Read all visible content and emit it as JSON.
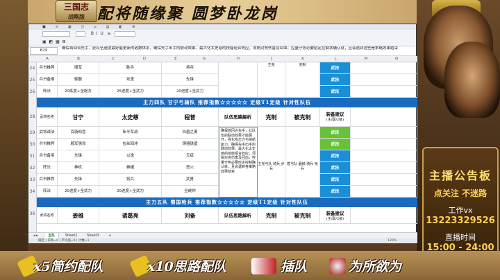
{
  "banner": {
    "logo_text": "三国志",
    "logo_sub": "战略版",
    "title": "配将随缘聚 圆梦卧龙岗"
  },
  "notice": {
    "title": "主播公告板",
    "line1": "点关注 不迷路",
    "wechat_label": "工作vx",
    "wechat_number": "13223329526",
    "live_label": "直播时间",
    "live_time": "15:00 - 24:00"
  },
  "bottom_bar": {
    "item1": "x5简约配队",
    "item2": "x10思路配队",
    "item3": "插队",
    "item4": "为所欲为"
  },
  "spreadsheet": {
    "name_box": "B29",
    "formula_text": "确保首回合先手，此队伍速度最好能更新的敌数体系，确保先手出手的联动效果，最大化太史慈的技能组合效应，须稍对充伤害及回血，控量守势必要给定控制状确认就，且会遇到这些是策略效果结束",
    "row_numbers": [
      "24",
      "25",
      "26",
      "",
      "28",
      "29",
      "30",
      "31",
      "32",
      "33",
      "34",
      "",
      "36"
    ],
    "col_letters": [
      "A",
      "B",
      "C",
      "D",
      "E",
      "F",
      "G",
      "H",
      "I",
      "J",
      "K",
      "L",
      "M",
      "N",
      "O"
    ],
    "top_rows": [
      {
        "role": "兵书推荐",
        "c": "顺军",
        "e": "胜兵",
        "g": "将兵",
        "rec": "武技"
      },
      {
        "role": "兵书备用",
        "c": "御器",
        "e": "攻坚",
        "g": "先锋",
        "rec": "武技"
      },
      {
        "role": "阵法",
        "c": "20练度+全配方",
        "e": "25进度+全武力",
        "g": "20进度+全武力",
        "rec": "武技"
      }
    ],
    "team4_bar": "主力四队 甘宁弓骑队 推荐指数☆☆☆☆☆ 定级T1定级 针对性队伍",
    "team4_header": {
      "role": "武将名称",
      "hero1": "甘宁",
      "hero2": "太史慈",
      "hero3": "程普",
      "analysis": "队伍思路解析",
      "counter": "克制",
      "countered": "被克制",
      "gear": "装备建议",
      "gear_sub": "(主/副/2级)"
    },
    "team4_rows": [
      {
        "role": "武将战法",
        "c": "百骑劫营",
        "e": "斩半军战",
        "g": "白眉之勇",
        "rec": "武技",
        "rec_color": "green"
      },
      {
        "role": "兵书推荐",
        "c": "顺军强攻",
        "e": "拉丝回冲",
        "g": "铜墙铁壁",
        "rec": "武技",
        "rec_color": "green"
      },
      {
        "role": "兵书备用",
        "c": "先锋",
        "e": "以逸",
        "g": "无疵",
        "rec": "武技",
        "rec_color": "blue"
      },
      {
        "role": "阵法",
        "c": "神机",
        "e": "帷幄",
        "g": "怒火",
        "rec": "武技",
        "rec_color": "blue"
      },
      {
        "role": "兵书推荐",
        "c": "先锋",
        "e": "将兵",
        "g": "武勇",
        "rec": "武技",
        "rec_color": "blue"
      },
      {
        "role": "阵法",
        "c": "20进度+全武力",
        "e": "20进度+全武力",
        "g": "全统帅",
        "rec": "武技",
        "rec_color": "blue"
      }
    ],
    "team4_note": "确保首回合先手，此队伍的联动效果才能展开，强化攻击力与续航能力，确保先手出手的联动效果，最大化太史慈的技能组合效应，须稍对克伤害及回血，控量守势必要时定控制确认就，且会遇到各策略效果结束",
    "team4_counter": "主克弓队 骑兵 步兵",
    "team4_countered": "盾弓队 器械 骑兵 枪兵",
    "team5_bar": "主力五队 蜀国枪兵 推荐指数☆☆☆☆☆ 定级T1定级 针对性队伍",
    "team5_header": {
      "role": "武将名称",
      "hero1": "姜维",
      "hero2": "诸葛亮",
      "hero3": "刘备",
      "analysis": "队伍思路解析",
      "counter": "克制",
      "countered": "被克制",
      "gear": "装备建议",
      "gear_sub": "(主/副/2级)"
    },
    "top_g_col": "主克",
    "top_k_col": "克制",
    "sheet_tabs": [
      "五队",
      "Sheet2",
      "Sheet3"
    ],
    "status_left": "确定 | 求和=0 | 平均值=0 | 计数=1",
    "zoom": "120%"
  }
}
